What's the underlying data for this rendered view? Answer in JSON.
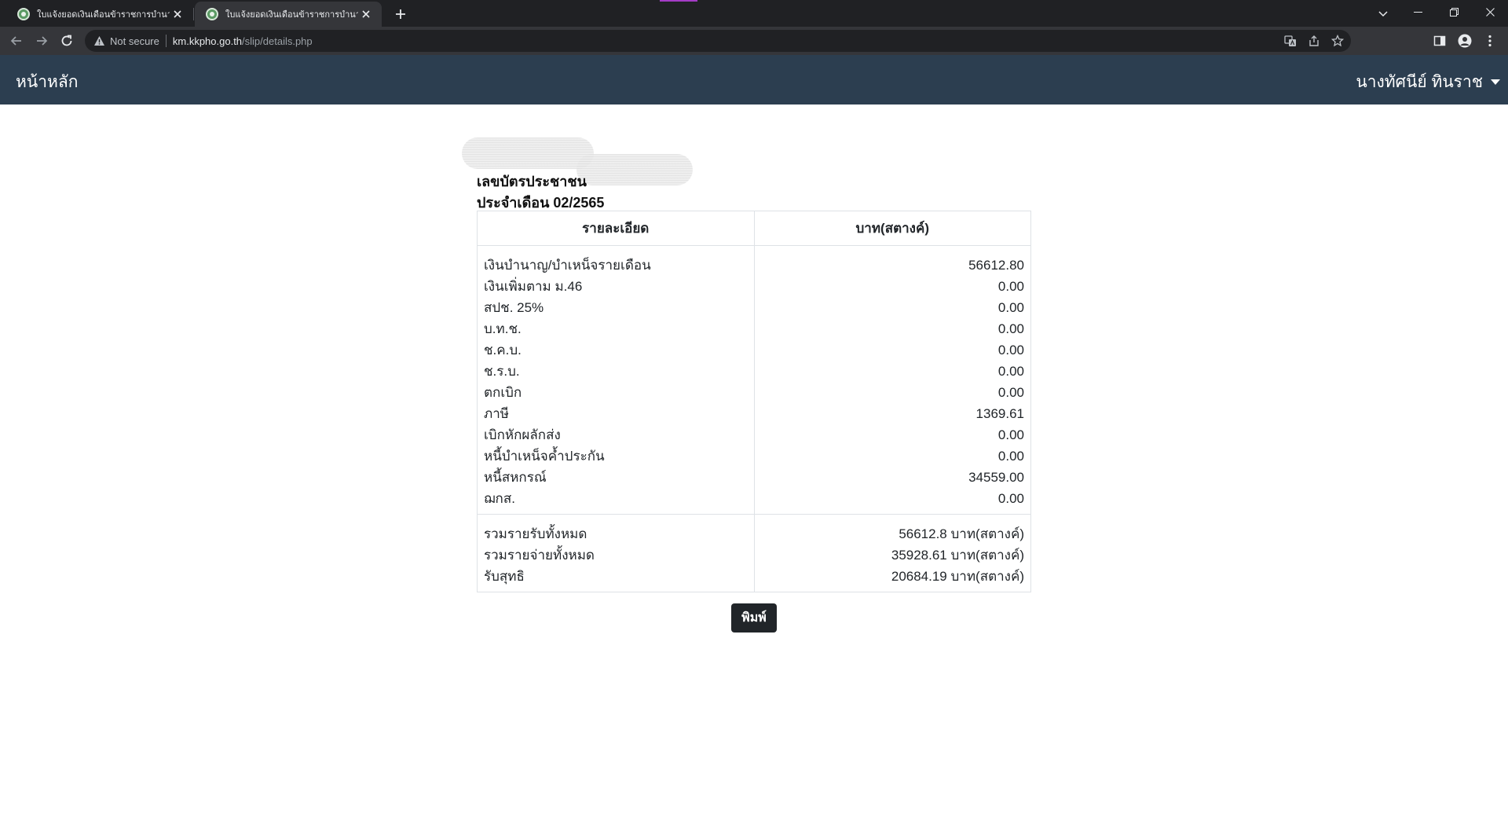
{
  "browser": {
    "tabs": [
      {
        "title": "ใบแจ้งยอดเงินเดือนข้าราชการบำนาญ/",
        "active": false
      },
      {
        "title": "ใบแจ้งยอดเงินเดือนข้าราชการบำนาญ/",
        "active": true
      }
    ],
    "omnibox": {
      "security_label": "Not secure",
      "host": "km.kkpho.go.th",
      "path": "/slip/details.php"
    },
    "icons": {
      "favicon": "site-emblem-icon",
      "tab_close": "close-icon",
      "new_tab": "plus-icon",
      "tab_search": "chevron-down-icon",
      "minimize": "minimize-icon",
      "maximize": "restore-icon",
      "close_window": "close-icon",
      "back": "arrow-left-icon",
      "forward": "arrow-right-icon",
      "reload": "reload-icon",
      "warning": "warning-triangle-icon",
      "translate": "translate-icon",
      "share": "share-icon",
      "bookmark": "star-icon",
      "side_panel": "side-panel-icon",
      "profile": "person-icon",
      "menu": "kebab-menu-icon"
    }
  },
  "navbar": {
    "brand": "หน้าหลัก",
    "user_name": "นางทัศนีย์ ทินราช",
    "background": "#2c3e50"
  },
  "slip": {
    "id_label": "เลขบัตรประชาชน",
    "month_label": "ประจำเดือน 02/2565",
    "headers": {
      "detail": "รายละเอียด",
      "amount": "บาท(สตางค์)"
    },
    "items": [
      {
        "label": "เงินบำนาญ/บำเหน็จรายเดือน",
        "amount": "56612.80"
      },
      {
        "label": "เงินเพิ่มตาม ม.46",
        "amount": "0.00"
      },
      {
        "label": "สปช. 25%",
        "amount": "0.00"
      },
      {
        "label": "บ.ท.ช.",
        "amount": "0.00"
      },
      {
        "label": "ช.ค.บ.",
        "amount": "0.00"
      },
      {
        "label": "ช.ร.บ.",
        "amount": "0.00"
      },
      {
        "label": "ตกเบิก",
        "amount": "0.00"
      },
      {
        "label": "ภาษี",
        "amount": "1369.61"
      },
      {
        "label": "เบิกหักผลักส่ง",
        "amount": "0.00"
      },
      {
        "label": "หนี้บำเหน็จค้ำประกัน",
        "amount": "0.00"
      },
      {
        "label": "หนี้สหกรณ์",
        "amount": "34559.00"
      },
      {
        "label": "ฌกส.",
        "amount": "0.00"
      }
    ],
    "totals": [
      {
        "label": "รวมรายรับทั้งหมด",
        "amount": "56612.8 บาท(สตางค์)"
      },
      {
        "label": "รวมรายจ่ายทั้งหมด",
        "amount": "35928.61 บาท(สตางค์)"
      },
      {
        "label": "รับสุทธิ",
        "amount": "20684.19 บาท(สตางค์)"
      }
    ]
  },
  "print_button": "พิมพ์"
}
